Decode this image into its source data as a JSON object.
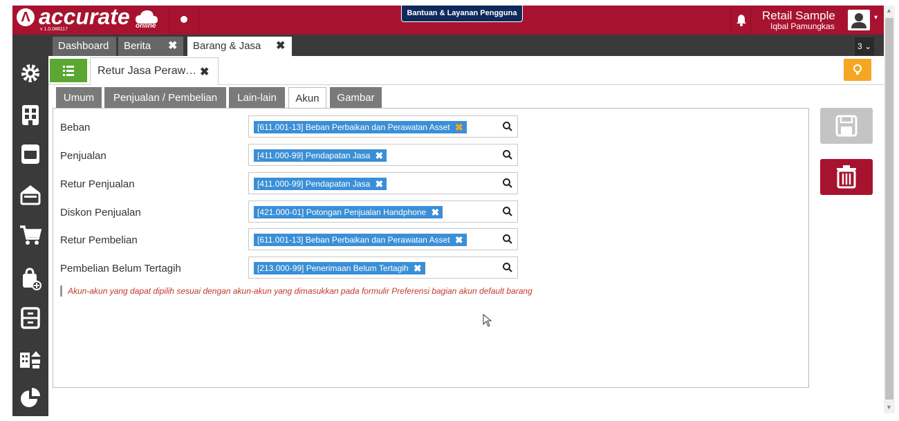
{
  "app": {
    "logo_text": "accurate",
    "logo_sub": "online",
    "version": "v 1.0.0#8117",
    "help_label": "Bantuan & Layanan Pengguna",
    "company": "Retail Sample",
    "user": "Iqbal Pamungkas"
  },
  "tabs": {
    "dashboard": "Dashboard",
    "berita": "Berita",
    "barang_jasa": "Barang & Jasa",
    "count": "3"
  },
  "form_tab": {
    "title": "Retur Jasa Peraw…"
  },
  "subtabs": [
    "Umum",
    "Penjualan / Pembelian",
    "Lain-lain",
    "Akun",
    "Gambar"
  ],
  "active_subtab": "Akun",
  "fields": [
    {
      "label": "Beban",
      "value": "[611.001-13] Beban Perbaikan dan Perawatan Asset"
    },
    {
      "label": "Penjualan",
      "value": "[411.000-99] Pendapatan Jasa"
    },
    {
      "label": "Retur Penjualan",
      "value": "[411.000-99] Pendapatan Jasa"
    },
    {
      "label": "Diskon Penjualan",
      "value": "[421.000-01] Potongan Penjualan Handphone"
    },
    {
      "label": "Retur Pembelian",
      "value": "[611.001-13] Beban Perbaikan dan Perawatan Asset"
    },
    {
      "label": "Pembelian Belum Tertagih",
      "value": "[213.000-99] Penerimaan Belum Tertagih"
    }
  ],
  "note": "Akun-akun yang dapat dipilih sesuai dengan akun-akun yang dimasukkan pada formulir Preferensi bagian akun default barang",
  "colors": {
    "brand": "#a7132f",
    "sidebar": "#3a3a3a",
    "chip": "#3a8fd6",
    "list_button": "#5aa832",
    "tip_button": "#f5a623",
    "note_text": "#c0392b"
  },
  "icons": {
    "sidebar": [
      "gear-icon",
      "building-icon",
      "ledger-icon",
      "wallet-icon",
      "cart-icon",
      "shopping-bag-add-icon",
      "cabinet-icon",
      "buildings-icon",
      "pie-chart-icon"
    ],
    "actions": [
      "save-icon",
      "trash-icon"
    ]
  }
}
